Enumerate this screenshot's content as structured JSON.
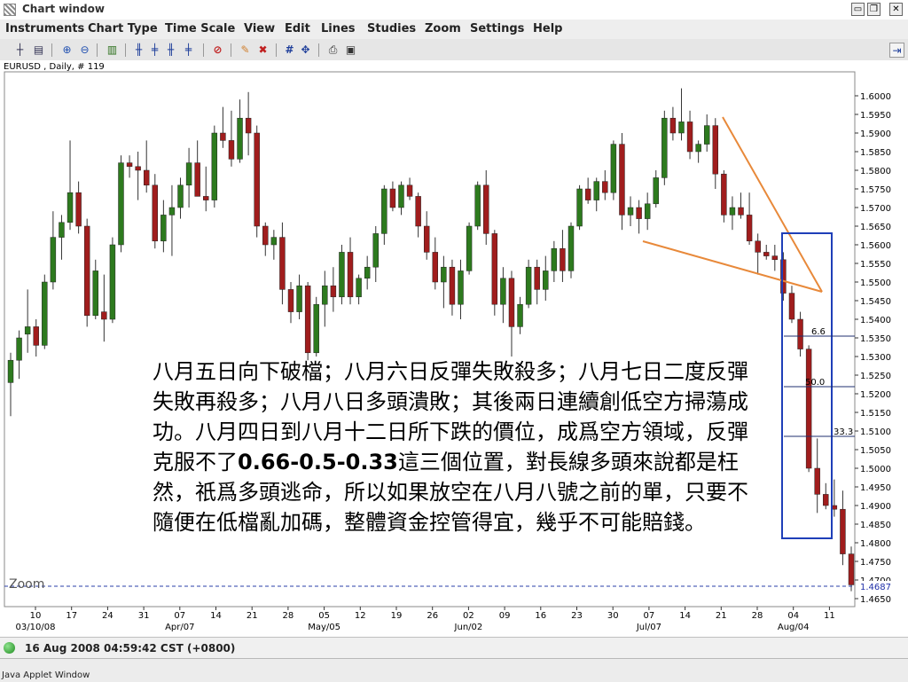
{
  "window": {
    "title": "Chart window",
    "minimize_icon": "minimize-icon",
    "restore_icon": "restore-icon",
    "close_icon": "close-icon"
  },
  "menu": [
    "Instruments",
    "Chart Type",
    "Time Scale",
    "View",
    "Edit",
    "Lines",
    "Studies",
    "Zoom",
    "Settings",
    "Help"
  ],
  "toolbar": {
    "icons": [
      "crosshair-icon",
      "rows-icon",
      "zoom-in-icon",
      "zoom-out-icon",
      "bar-chart-icon",
      "candles-icon",
      "ohlc-icon",
      "ohlc-alt-icon",
      "line-chart-icon",
      "no-draw-icon",
      "eraser-icon",
      "delete-icon",
      "grid-icon",
      "pan-icon",
      "print-icon",
      "print-preview-icon",
      "dock-icon"
    ]
  },
  "chart": {
    "header": "EURUSD , Daily, # 119",
    "zoom_label": "Zoom",
    "current_price": "1.4687",
    "fib_labels": [
      "6.6",
      "50.0",
      "33.3"
    ],
    "colors": {
      "up": "#2d7a1e",
      "down": "#a01d1d",
      "trend": "#e8893a",
      "box": "#1f3fb8",
      "price": "#1f2fa8"
    }
  },
  "annotation": {
    "part1": "八月五日向下破檔；八月六日反彈失敗殺多；八月七日二度反彈失敗再殺多；八月八日多頭潰敗；其後兩日連續創低空方掃蕩成功。八月四日到八月十二日所下跌的價位，成爲空方領域，反彈克服不了",
    "bold": "0.66-0.5-0.33",
    "part2": "這三個位置，對長線多頭來說都是枉然，祇爲多頭逃命，所以如果放空在八月八號之前的單，只要不隨便在低檔亂加碼，整體資金控管得宜，幾乎不可能賠錢。"
  },
  "status": {
    "datetime": "16 Aug 2008 04:59:42  CST (+0800)"
  },
  "applet": {
    "label": "Java Applet Window"
  },
  "chart_data": {
    "type": "candlestick",
    "instrument": "EURUSD",
    "timeframe": "Daily",
    "y_ticks": [
      "1.6000",
      "1.5950",
      "1.5900",
      "1.5850",
      "1.5800",
      "1.5750",
      "1.5700",
      "1.5650",
      "1.5600",
      "1.5550",
      "1.5500",
      "1.5450",
      "1.5400",
      "1.5350",
      "1.5300",
      "1.5250",
      "1.5200",
      "1.5150",
      "1.5100",
      "1.5050",
      "1.5000",
      "1.4950",
      "1.4900",
      "1.4850",
      "1.4800",
      "1.4750",
      "1.4700",
      "1.4650"
    ],
    "ylim": [
      1.465,
      1.6
    ],
    "x_ticks": [
      "10",
      "17",
      "24",
      "31",
      "07",
      "14",
      "21",
      "28",
      "05",
      "12",
      "19",
      "26",
      "02",
      "09",
      "16",
      "23",
      "30",
      "07",
      "14",
      "21",
      "28",
      "04",
      "11"
    ],
    "x_months": [
      "03/10/08",
      "Apr/07",
      "May/05",
      "Jun/02",
      "Jul/07",
      "Aug/04"
    ],
    "candles": [
      {
        "o": 1.523,
        "h": 1.531,
        "l": 1.514,
        "c": 1.529
      },
      {
        "o": 1.529,
        "h": 1.537,
        "l": 1.524,
        "c": 1.535
      },
      {
        "o": 1.536,
        "h": 1.548,
        "l": 1.531,
        "c": 1.538
      },
      {
        "o": 1.538,
        "h": 1.54,
        "l": 1.53,
        "c": 1.533
      },
      {
        "o": 1.533,
        "h": 1.552,
        "l": 1.532,
        "c": 1.55
      },
      {
        "o": 1.55,
        "h": 1.569,
        "l": 1.548,
        "c": 1.562
      },
      {
        "o": 1.562,
        "h": 1.568,
        "l": 1.556,
        "c": 1.566
      },
      {
        "o": 1.566,
        "h": 1.588,
        "l": 1.564,
        "c": 1.574
      },
      {
        "o": 1.574,
        "h": 1.577,
        "l": 1.563,
        "c": 1.565
      },
      {
        "o": 1.565,
        "h": 1.567,
        "l": 1.538,
        "c": 1.541
      },
      {
        "o": 1.541,
        "h": 1.556,
        "l": 1.54,
        "c": 1.553
      },
      {
        "o": 1.542,
        "h": 1.552,
        "l": 1.534,
        "c": 1.54
      },
      {
        "o": 1.54,
        "h": 1.562,
        "l": 1.539,
        "c": 1.56
      },
      {
        "o": 1.56,
        "h": 1.584,
        "l": 1.558,
        "c": 1.582
      },
      {
        "o": 1.582,
        "h": 1.584,
        "l": 1.578,
        "c": 1.581
      },
      {
        "o": 1.581,
        "h": 1.585,
        "l": 1.572,
        "c": 1.58
      },
      {
        "o": 1.58,
        "h": 1.588,
        "l": 1.574,
        "c": 1.576
      },
      {
        "o": 1.576,
        "h": 1.579,
        "l": 1.559,
        "c": 1.561
      },
      {
        "o": 1.561,
        "h": 1.572,
        "l": 1.558,
        "c": 1.568
      },
      {
        "o": 1.568,
        "h": 1.576,
        "l": 1.557,
        "c": 1.57
      },
      {
        "o": 1.57,
        "h": 1.578,
        "l": 1.567,
        "c": 1.576
      },
      {
        "o": 1.576,
        "h": 1.586,
        "l": 1.57,
        "c": 1.582
      },
      {
        "o": 1.582,
        "h": 1.588,
        "l": 1.576,
        "c": 1.573
      },
      {
        "o": 1.573,
        "h": 1.581,
        "l": 1.569,
        "c": 1.572
      },
      {
        "o": 1.572,
        "h": 1.592,
        "l": 1.57,
        "c": 1.59
      },
      {
        "o": 1.59,
        "h": 1.597,
        "l": 1.586,
        "c": 1.588
      },
      {
        "o": 1.588,
        "h": 1.596,
        "l": 1.581,
        "c": 1.583
      },
      {
        "o": 1.583,
        "h": 1.599,
        "l": 1.582,
        "c": 1.594
      },
      {
        "o": 1.594,
        "h": 1.601,
        "l": 1.584,
        "c": 1.59
      },
      {
        "o": 1.59,
        "h": 1.592,
        "l": 1.562,
        "c": 1.565
      },
      {
        "o": 1.565,
        "h": 1.566,
        "l": 1.557,
        "c": 1.56
      },
      {
        "o": 1.56,
        "h": 1.564,
        "l": 1.556,
        "c": 1.562
      },
      {
        "o": 1.562,
        "h": 1.566,
        "l": 1.544,
        "c": 1.548
      },
      {
        "o": 1.548,
        "h": 1.55,
        "l": 1.539,
        "c": 1.542
      },
      {
        "o": 1.542,
        "h": 1.552,
        "l": 1.54,
        "c": 1.549
      },
      {
        "o": 1.549,
        "h": 1.55,
        "l": 1.529,
        "c": 1.531
      },
      {
        "o": 1.531,
        "h": 1.546,
        "l": 1.53,
        "c": 1.544
      },
      {
        "o": 1.544,
        "h": 1.553,
        "l": 1.538,
        "c": 1.549
      },
      {
        "o": 1.549,
        "h": 1.554,
        "l": 1.542,
        "c": 1.546
      },
      {
        "o": 1.546,
        "h": 1.56,
        "l": 1.544,
        "c": 1.558
      },
      {
        "o": 1.558,
        "h": 1.562,
        "l": 1.544,
        "c": 1.546
      },
      {
        "o": 1.546,
        "h": 1.552,
        "l": 1.544,
        "c": 1.551
      },
      {
        "o": 1.551,
        "h": 1.557,
        "l": 1.548,
        "c": 1.554
      },
      {
        "o": 1.554,
        "h": 1.565,
        "l": 1.55,
        "c": 1.563
      },
      {
        "o": 1.563,
        "h": 1.576,
        "l": 1.56,
        "c": 1.575
      },
      {
        "o": 1.575,
        "h": 1.577,
        "l": 1.569,
        "c": 1.57
      },
      {
        "o": 1.57,
        "h": 1.577,
        "l": 1.568,
        "c": 1.576
      },
      {
        "o": 1.576,
        "h": 1.578,
        "l": 1.572,
        "c": 1.573
      },
      {
        "o": 1.573,
        "h": 1.574,
        "l": 1.562,
        "c": 1.565
      },
      {
        "o": 1.565,
        "h": 1.569,
        "l": 1.556,
        "c": 1.558
      },
      {
        "o": 1.558,
        "h": 1.562,
        "l": 1.548,
        "c": 1.55
      },
      {
        "o": 1.55,
        "h": 1.557,
        "l": 1.543,
        "c": 1.554
      },
      {
        "o": 1.554,
        "h": 1.556,
        "l": 1.541,
        "c": 1.544
      },
      {
        "o": 1.544,
        "h": 1.556,
        "l": 1.54,
        "c": 1.553
      },
      {
        "o": 1.553,
        "h": 1.566,
        "l": 1.552,
        "c": 1.565
      },
      {
        "o": 1.565,
        "h": 1.577,
        "l": 1.564,
        "c": 1.576
      },
      {
        "o": 1.576,
        "h": 1.58,
        "l": 1.56,
        "c": 1.563
      },
      {
        "o": 1.563,
        "h": 1.564,
        "l": 1.541,
        "c": 1.544
      },
      {
        "o": 1.544,
        "h": 1.554,
        "l": 1.539,
        "c": 1.551
      },
      {
        "o": 1.551,
        "h": 1.553,
        "l": 1.53,
        "c": 1.538
      },
      {
        "o": 1.538,
        "h": 1.546,
        "l": 1.536,
        "c": 1.544
      },
      {
        "o": 1.544,
        "h": 1.556,
        "l": 1.543,
        "c": 1.554
      },
      {
        "o": 1.554,
        "h": 1.556,
        "l": 1.544,
        "c": 1.548
      },
      {
        "o": 1.548,
        "h": 1.557,
        "l": 1.545,
        "c": 1.553
      },
      {
        "o": 1.553,
        "h": 1.561,
        "l": 1.55,
        "c": 1.559
      },
      {
        "o": 1.559,
        "h": 1.564,
        "l": 1.55,
        "c": 1.553
      },
      {
        "o": 1.553,
        "h": 1.566,
        "l": 1.551,
        "c": 1.565
      },
      {
        "o": 1.565,
        "h": 1.576,
        "l": 1.564,
        "c": 1.575
      },
      {
        "o": 1.575,
        "h": 1.578,
        "l": 1.571,
        "c": 1.572
      },
      {
        "o": 1.572,
        "h": 1.578,
        "l": 1.569,
        "c": 1.577
      },
      {
        "o": 1.577,
        "h": 1.58,
        "l": 1.572,
        "c": 1.574
      },
      {
        "o": 1.574,
        "h": 1.588,
        "l": 1.572,
        "c": 1.587
      },
      {
        "o": 1.587,
        "h": 1.59,
        "l": 1.564,
        "c": 1.568
      },
      {
        "o": 1.568,
        "h": 1.573,
        "l": 1.565,
        "c": 1.57
      },
      {
        "o": 1.57,
        "h": 1.572,
        "l": 1.563,
        "c": 1.567
      },
      {
        "o": 1.567,
        "h": 1.574,
        "l": 1.564,
        "c": 1.571
      },
      {
        "o": 1.571,
        "h": 1.58,
        "l": 1.57,
        "c": 1.578
      },
      {
        "o": 1.578,
        "h": 1.596,
        "l": 1.576,
        "c": 1.594
      },
      {
        "o": 1.594,
        "h": 1.597,
        "l": 1.588,
        "c": 1.59
      },
      {
        "o": 1.59,
        "h": 1.602,
        "l": 1.588,
        "c": 1.593
      },
      {
        "o": 1.593,
        "h": 1.596,
        "l": 1.583,
        "c": 1.585
      },
      {
        "o": 1.585,
        "h": 1.588,
        "l": 1.582,
        "c": 1.587
      },
      {
        "o": 1.587,
        "h": 1.595,
        "l": 1.585,
        "c": 1.592
      },
      {
        "o": 1.592,
        "h": 1.594,
        "l": 1.575,
        "c": 1.579
      },
      {
        "o": 1.579,
        "h": 1.58,
        "l": 1.566,
        "c": 1.568
      },
      {
        "o": 1.568,
        "h": 1.573,
        "l": 1.564,
        "c": 1.57
      },
      {
        "o": 1.57,
        "h": 1.574,
        "l": 1.567,
        "c": 1.568
      },
      {
        "o": 1.568,
        "h": 1.574,
        "l": 1.56,
        "c": 1.561
      },
      {
        "o": 1.561,
        "h": 1.563,
        "l": 1.552,
        "c": 1.558
      },
      {
        "o": 1.558,
        "h": 1.56,
        "l": 1.556,
        "c": 1.557
      },
      {
        "o": 1.557,
        "h": 1.56,
        "l": 1.553,
        "c": 1.556
      },
      {
        "o": 1.556,
        "h": 1.558,
        "l": 1.545,
        "c": 1.547
      },
      {
        "o": 1.547,
        "h": 1.549,
        "l": 1.539,
        "c": 1.54
      },
      {
        "o": 1.54,
        "h": 1.542,
        "l": 1.53,
        "c": 1.532
      },
      {
        "o": 1.532,
        "h": 1.533,
        "l": 1.499,
        "c": 1.5
      },
      {
        "o": 1.5,
        "h": 1.508,
        "l": 1.488,
        "c": 1.493
      },
      {
        "o": 1.493,
        "h": 1.496,
        "l": 1.489,
        "c": 1.49
      },
      {
        "o": 1.49,
        "h": 1.497,
        "l": 1.487,
        "c": 1.489
      },
      {
        "o": 1.489,
        "h": 1.494,
        "l": 1.474,
        "c": 1.477
      },
      {
        "o": 1.477,
        "h": 1.479,
        "l": 1.467,
        "c": 1.4687
      }
    ]
  }
}
